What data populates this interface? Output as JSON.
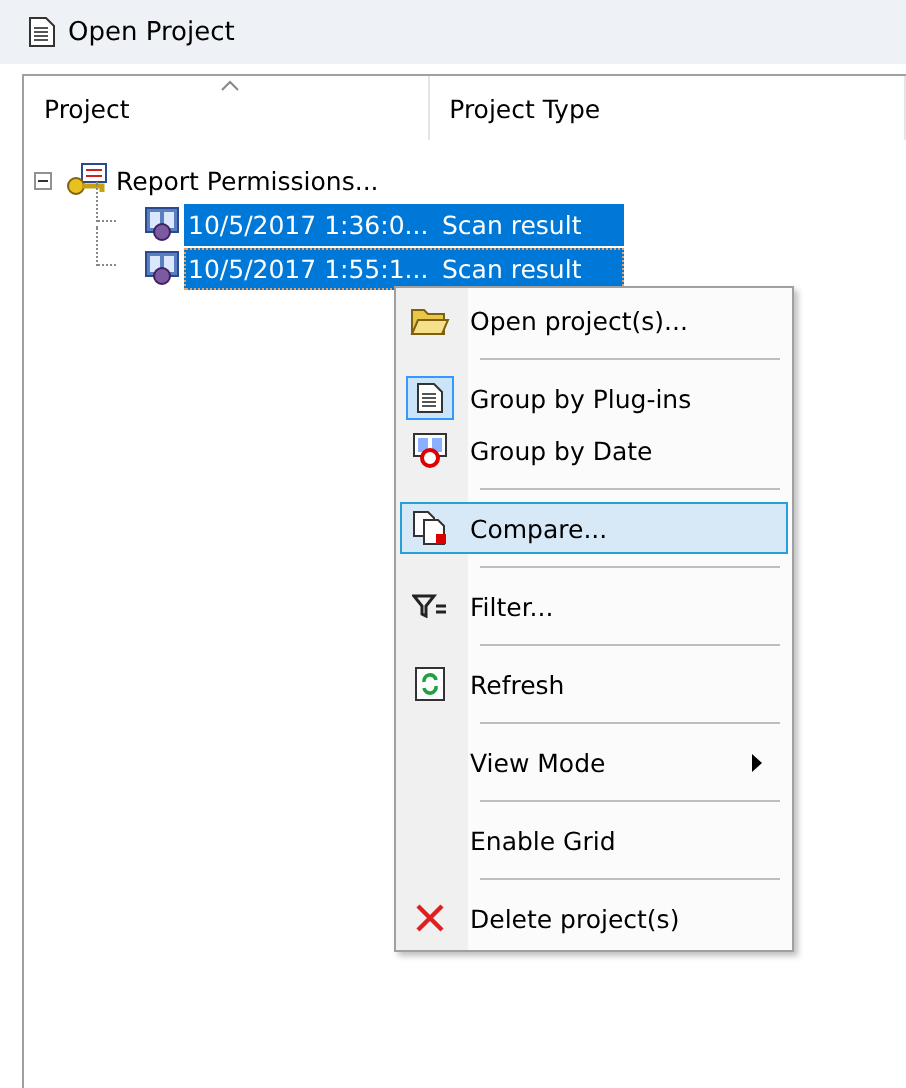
{
  "window": {
    "title": "Open Project"
  },
  "columns": [
    "Project",
    "Project Type"
  ],
  "tree": [
    {
      "name": "Report Permissions...",
      "expanded": true,
      "children": [
        {
          "name": "10/5/2017 1:36:0...",
          "type": "Scan result",
          "selected": true,
          "focused": false
        },
        {
          "name": "10/5/2017 1:55:1...",
          "type": "Scan result",
          "selected": true,
          "focused": true
        }
      ]
    }
  ],
  "context_menu": [
    {
      "kind": "item",
      "label": "Open project(s)...",
      "checked": false,
      "highlighted": false
    },
    {
      "kind": "separator"
    },
    {
      "kind": "item",
      "label": "Group by Plug-ins",
      "checked": true,
      "highlighted": false
    },
    {
      "kind": "item",
      "label": "Group by Date",
      "checked": false,
      "highlighted": false
    },
    {
      "kind": "separator"
    },
    {
      "kind": "item",
      "label": "Compare...",
      "checked": false,
      "highlighted": true
    },
    {
      "kind": "separator"
    },
    {
      "kind": "item",
      "label": "Filter...",
      "checked": false,
      "highlighted": false
    },
    {
      "kind": "separator"
    },
    {
      "kind": "item",
      "label": "Refresh",
      "checked": false,
      "highlighted": false
    },
    {
      "kind": "separator"
    },
    {
      "kind": "submenu",
      "label": "View Mode"
    },
    {
      "kind": "separator"
    },
    {
      "kind": "item",
      "label": "Enable Grid",
      "checked": false,
      "highlighted": false
    },
    {
      "kind": "separator"
    },
    {
      "kind": "item",
      "label": "Delete project(s)",
      "checked": false,
      "highlighted": false
    }
  ]
}
